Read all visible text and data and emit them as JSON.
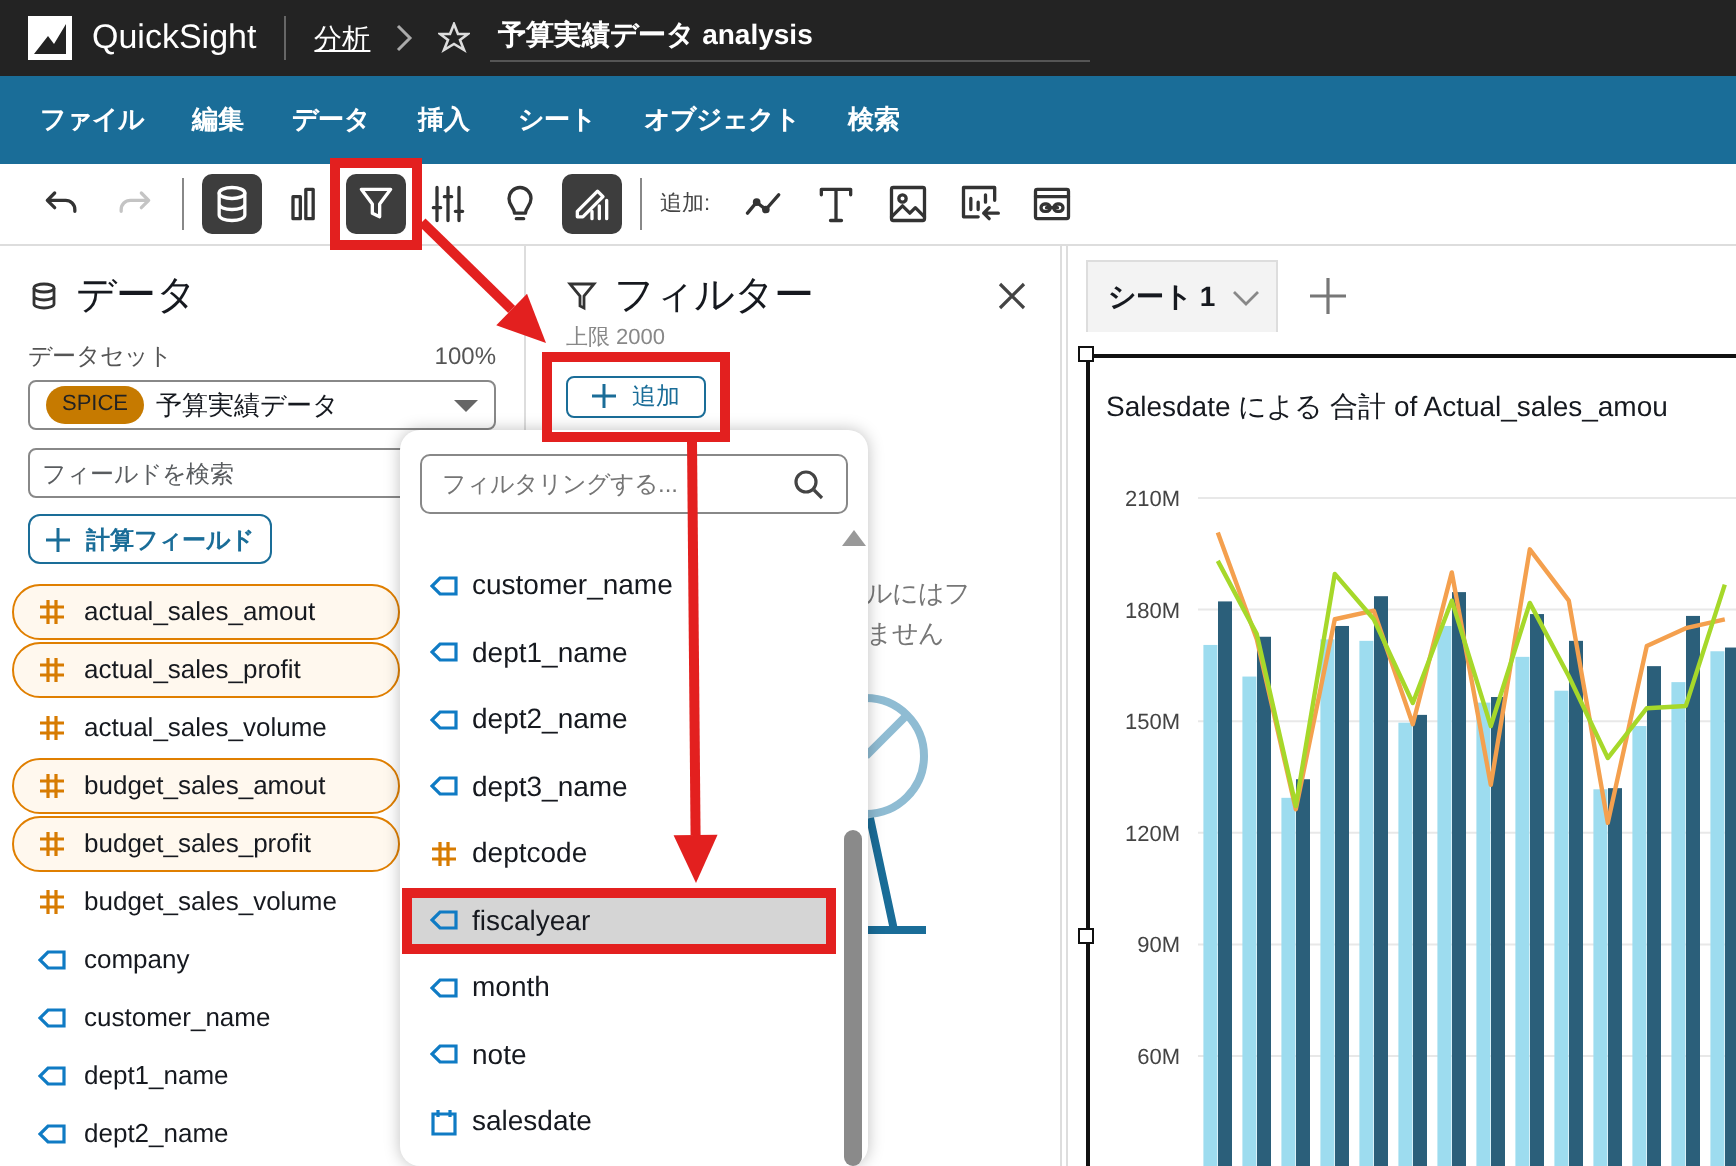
{
  "top_bar": {
    "product": "QuickSight",
    "breadcrumb": "分析",
    "title": "予算実績データ analysis",
    "starred": false
  },
  "menu": [
    "ファイル",
    "編集",
    "データ",
    "挿入",
    "シート",
    "オブジェクト",
    "検索"
  ],
  "toolbar": {
    "history": [
      {
        "kind": "undo",
        "disabled": false
      },
      {
        "kind": "redo",
        "disabled": true
      }
    ],
    "tools": [
      {
        "kind": "dataset",
        "selected": true,
        "callout": false
      },
      {
        "kind": "visuals",
        "selected": false,
        "callout": false
      },
      {
        "kind": "filter",
        "selected": true,
        "callout": true
      },
      {
        "kind": "parameters",
        "selected": false,
        "callout": false
      },
      {
        "kind": "insights",
        "selected": false,
        "callout": false
      },
      {
        "kind": "themes",
        "selected": true,
        "callout": false
      }
    ],
    "add_label": "追加:",
    "add_tools": [
      {
        "kind": "line"
      },
      {
        "kind": "text"
      },
      {
        "kind": "image"
      },
      {
        "kind": "insight"
      },
      {
        "kind": "embed"
      }
    ]
  },
  "data_panel": {
    "title": "データ",
    "dataset_label": "データセット",
    "dataset_percent": "100%",
    "dataset": {
      "badge": "SPICE",
      "name": "予算実績データ"
    },
    "search": {
      "placeholder": "フィールドを検索"
    },
    "calc_button": "計算フィールド",
    "fields": [
      {
        "name": "actual_sales_amout",
        "kind": "measure",
        "selected": true
      },
      {
        "name": "actual_sales_profit",
        "kind": "measure",
        "selected": true
      },
      {
        "name": "actual_sales_volume",
        "kind": "measure",
        "selected": false
      },
      {
        "name": "budget_sales_amout",
        "kind": "measure",
        "selected": true
      },
      {
        "name": "budget_sales_profit",
        "kind": "measure",
        "selected": true
      },
      {
        "name": "budget_sales_volume",
        "kind": "measure",
        "selected": false
      },
      {
        "name": "company",
        "kind": "dimension",
        "selected": false
      },
      {
        "name": "customer_name",
        "kind": "dimension",
        "selected": false
      },
      {
        "name": "dept1_name",
        "kind": "dimension",
        "selected": false
      },
      {
        "name": "dept2_name",
        "kind": "dimension",
        "selected": false
      }
    ]
  },
  "filter_panel": {
    "title": "フィルター",
    "limit": "上限 2000",
    "add_button": "追加",
    "add_callout": true,
    "empty_text": [
      "ルにはフ",
      "ません"
    ]
  },
  "filter_menu": {
    "placeholder": "フィルタリングする...",
    "items": [
      {
        "name": "customer_name",
        "kind": "dimension",
        "selected": false,
        "callout": false
      },
      {
        "name": "dept1_name",
        "kind": "dimension",
        "selected": false,
        "callout": false
      },
      {
        "name": "dept2_name",
        "kind": "dimension",
        "selected": false,
        "callout": false
      },
      {
        "name": "dept3_name",
        "kind": "dimension",
        "selected": false,
        "callout": false
      },
      {
        "name": "deptcode",
        "kind": "measure",
        "selected": false,
        "callout": false
      },
      {
        "name": "fiscalyear",
        "kind": "dimension",
        "selected": true,
        "callout": true
      },
      {
        "name": "month",
        "kind": "dimension",
        "selected": false,
        "callout": false
      },
      {
        "name": "note",
        "kind": "dimension",
        "selected": false,
        "callout": false
      },
      {
        "name": "salesdate",
        "kind": "date",
        "selected": false,
        "callout": false
      }
    ]
  },
  "sheets": [
    {
      "label": "シート 1",
      "selected": true
    }
  ],
  "visual": {
    "title": "Salesdate による 合計 of Actual_sales_amou",
    "chart_data": {
      "type": "bar",
      "grid": true,
      "ylim": [
        30,
        210
      ],
      "yticks": [
        {
          "value": 60,
          "label": "60M"
        },
        {
          "value": 90,
          "label": "90M"
        },
        {
          "value": 120,
          "label": "120M"
        },
        {
          "value": 150,
          "label": "150M"
        },
        {
          "value": 180,
          "label": "180M"
        },
        {
          "value": 210,
          "label": "210M"
        }
      ],
      "series": [
        {
          "type": "bar",
          "color": "#9ddcef",
          "values": [
            170.5,
            162,
            129.4,
            172,
            171.6,
            149.6,
            175.6,
            155,
            167.3,
            158.2,
            131.7,
            148.7,
            160.5,
            168.8
          ]
        },
        {
          "type": "bar",
          "color": "#2b5f7a",
          "values": [
            182.2,
            172.7,
            134.4,
            175.6,
            183.6,
            151.7,
            184.7,
            156.5,
            178.8,
            171.6,
            132,
            164.8,
            178.3,
            169.8
          ]
        },
        {
          "type": "line",
          "color": "#f4a04e",
          "values": [
            200.7,
            172,
            126.3,
            177.4,
            179.7,
            149.2,
            190,
            132.9,
            196.2,
            182.4,
            122.7,
            170.2,
            175,
            177.4
          ]
        },
        {
          "type": "line",
          "color": "#a6d82a",
          "values": [
            193.1,
            173.4,
            127.2,
            189.6,
            177.4,
            154.9,
            182.4,
            148.7,
            181.8,
            162.1,
            140.1,
            153.5,
            154.1,
            186.7
          ]
        }
      ]
    }
  }
}
